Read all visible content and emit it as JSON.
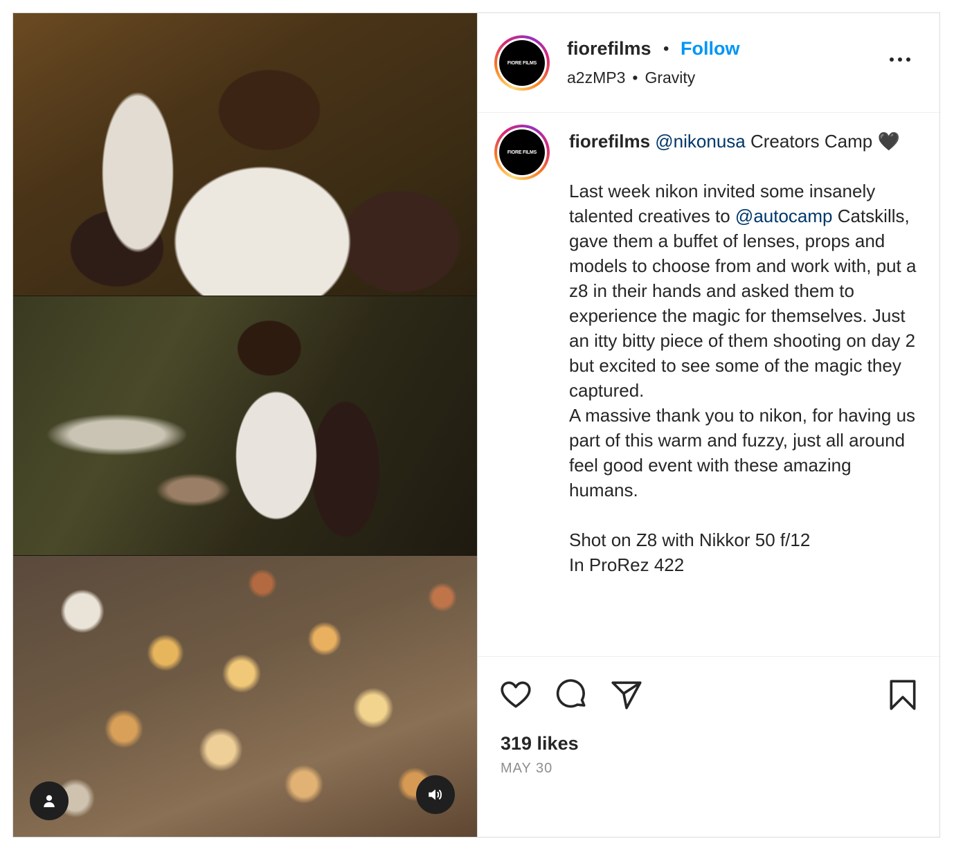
{
  "account": {
    "username": "fiorefilms",
    "avatar_text": "FIORE FILMS",
    "follow_label": "Follow",
    "separator": "•"
  },
  "audio": {
    "artist": "a2zMP3",
    "separator": "•",
    "track": "Gravity"
  },
  "caption": {
    "username": "fiorefilms",
    "mention_1": "@nikonusa",
    "text_1": " Creators Camp 🖤\n\nLast week nikon invited some insanely talented creatives to ",
    "mention_2": "@autocamp",
    "text_2": " Catskills, gave them a buffet of lenses, props and models to choose from and work with, put a z8 in their hands and asked them to experience the magic for themselves. Just an itty bitty piece of them shooting on day 2 but excited to see some of the magic they captured.\nA massive thank you to nikon, for having us part of this warm and fuzzy, just all around feel good event with these amazing humans.\n\nShot on Z8 with Nikkor 50 f/12\nIn ProRez 422"
  },
  "stats": {
    "likes": "319 likes",
    "date": "MAY 30"
  },
  "icons": {
    "like": "heart-icon",
    "comment": "comment-icon",
    "share": "paper-plane-icon",
    "save": "bookmark-icon",
    "more": "more-horizontal-icon",
    "user_tag": "person-icon",
    "sound": "speaker-icon"
  },
  "colors": {
    "follow": "#0095f6",
    "mention": "#00376b",
    "secondary_text": "#8e8e8e"
  }
}
